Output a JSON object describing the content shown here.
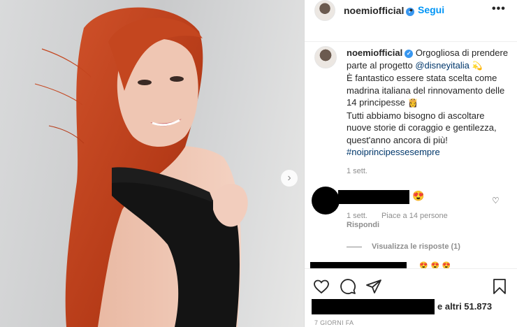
{
  "post": {
    "username": "noemiofficial",
    "verified_icon": "verified-badge-icon",
    "separator": "•",
    "follow_label": "Segui",
    "more_icon": "•••"
  },
  "caption": {
    "username": "noemiofficial",
    "line1": "Orgogliosa di prendere parte al progetto",
    "mention": "@disneyitalia",
    "emoji1": "💫",
    "line2": "È fantastico essere stata scelta come madrina italiana del rinnovamento delle 14 principesse",
    "emoji2": "👸",
    "line3": "Tutti abbiamo bisogno di ascoltare nuove storie di coraggio e gentilezza, quest'anno ancora di più!",
    "hashtag": "#noiprincipessesempre",
    "time": "1 sett."
  },
  "comment": {
    "emoji": "😍",
    "time": "1 sett.",
    "likes": "Piace a 14 persone",
    "reply_label": "Rispondi",
    "view_replies_label": "Visualizza le risposte (1)",
    "faded_emojis": "😍😍😍"
  },
  "footer": {
    "likes_text": "e altri 51.873",
    "date": "7 GIORNI FA"
  },
  "carousel": {
    "next_icon": "›"
  },
  "colors": {
    "accent": "#0095f6",
    "verified": "#3897f0",
    "hair": "#c4461f",
    "muted": "#8e8e8e"
  }
}
